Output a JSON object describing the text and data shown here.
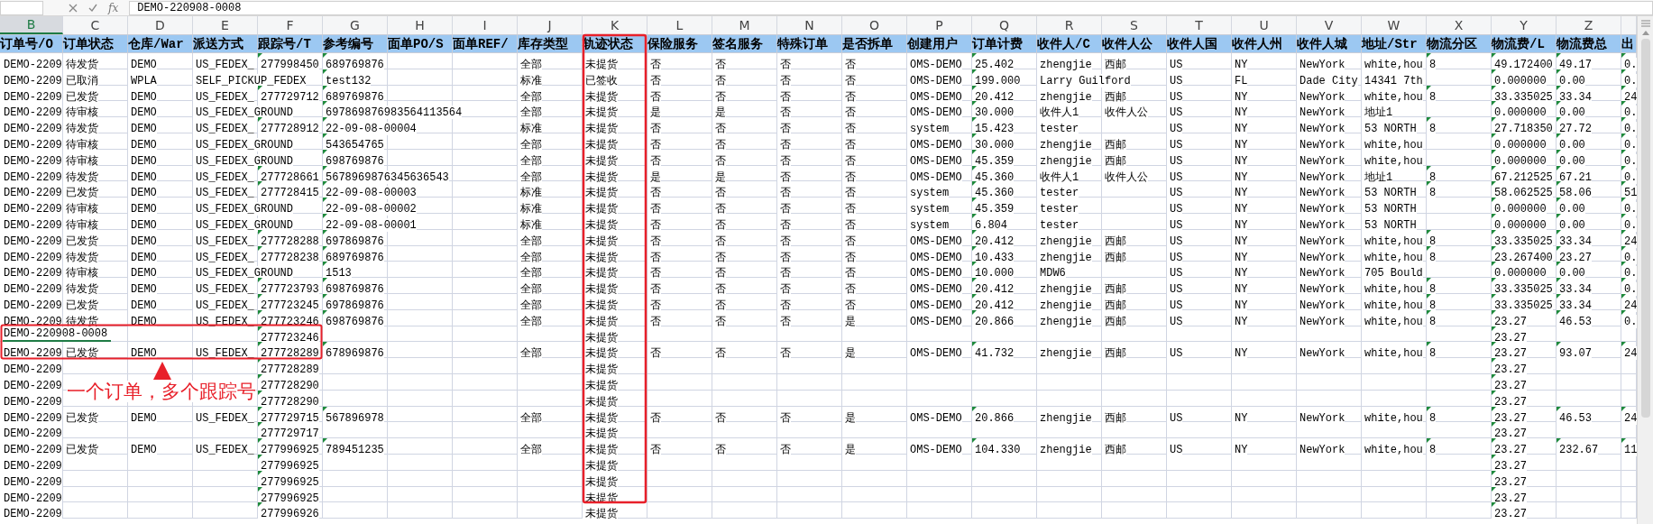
{
  "formula_bar": {
    "function_label": "fx",
    "value": "DEMO-220908-0008"
  },
  "columns": [
    {
      "letter": "B",
      "header": "订单号/O",
      "selected": true,
      "text_number_flag": false
    },
    {
      "letter": "C",
      "header": "订单状态",
      "selected": false,
      "text_number_flag": false
    },
    {
      "letter": "D",
      "header": "仓库/War",
      "selected": false,
      "text_number_flag": false
    },
    {
      "letter": "E",
      "header": "派送方式",
      "selected": false,
      "text_number_flag": false
    },
    {
      "letter": "F",
      "header": "跟踪号/T",
      "selected": false,
      "text_number_flag": true
    },
    {
      "letter": "G",
      "header": "参考编号",
      "selected": false,
      "text_number_flag": true
    },
    {
      "letter": "H",
      "header": "面单PO/S",
      "selected": false
    },
    {
      "letter": "I",
      "header": "面单REF/",
      "selected": false
    },
    {
      "letter": "J",
      "header": "库存类型",
      "selected": false,
      "text_number_flag": false
    },
    {
      "letter": "K",
      "header": "轨迹状态",
      "selected": false,
      "text_number_flag": false
    },
    {
      "letter": "L",
      "header": "保险服务",
      "selected": false,
      "text_number_flag": false
    },
    {
      "letter": "M",
      "header": "签名服务",
      "selected": false,
      "text_number_flag": false
    },
    {
      "letter": "N",
      "header": "特殊订单",
      "selected": false,
      "text_number_flag": false
    },
    {
      "letter": "O",
      "header": "是否拆单",
      "selected": false,
      "text_number_flag": false
    },
    {
      "letter": "P",
      "header": "创建用户",
      "selected": false,
      "text_number_flag": false
    },
    {
      "letter": "Q",
      "header": "订单计费",
      "selected": false,
      "text_number_flag": true
    },
    {
      "letter": "R",
      "header": "收件人/C",
      "selected": false,
      "text_number_flag": false
    },
    {
      "letter": "S",
      "header": "收件人公",
      "selected": false,
      "text_number_flag": false
    },
    {
      "letter": "T",
      "header": "收件人国",
      "selected": false,
      "text_number_flag": false
    },
    {
      "letter": "U",
      "header": "收件人州",
      "selected": false,
      "text_number_flag": false
    },
    {
      "letter": "V",
      "header": "收件人城",
      "selected": false,
      "text_number_flag": false
    },
    {
      "letter": "W",
      "header": "地址/Str",
      "selected": false,
      "text_number_flag": false
    },
    {
      "letter": "X",
      "header": "物流分区",
      "selected": false,
      "text_number_flag": true
    },
    {
      "letter": "Y",
      "header": "物流费/L",
      "selected": false,
      "text_number_flag": true
    },
    {
      "letter": "Z",
      "header": "物流费总",
      "selected": false,
      "text_number_flag": true
    },
    {
      "header": "出",
      "selected": false,
      "text_number_flag": true
    }
  ],
  "rows": [
    {
      "editing": false,
      "cells": [
        "DEMO-2209",
        "待发货",
        "DEMO",
        "US_FEDEX_",
        "277998450",
        "689769876",
        "",
        "",
        "全部",
        "未提货",
        "否",
        "否",
        "否",
        "否",
        "OMS-DEMO",
        "25.402",
        "zhengjie",
        "西邮",
        "US",
        "NY",
        "NewYork",
        "white,hou",
        "8",
        "49.172400",
        "49.17",
        "0."
      ]
    },
    {
      "editing": false,
      "cells": [
        "DEMO-2209",
        "已取消",
        "WPLA",
        "SELF_PICKUP_FEDEX",
        "",
        "test132",
        "",
        "",
        "标准",
        "已签收",
        "否",
        "否",
        "否",
        "否",
        "OMS-DEMO",
        "199.000",
        "Larry Guilford",
        "",
        "US",
        "FL",
        "Dade City",
        "14341 7th",
        "",
        "0.000000",
        "0.00",
        "0."
      ]
    },
    {
      "editing": false,
      "cells": [
        "DEMO-2209",
        "已发货",
        "DEMO",
        "US_FEDEX_",
        "277729712",
        "689769876",
        "",
        "",
        "全部",
        "未提货",
        "否",
        "否",
        "否",
        "否",
        "OMS-DEMO",
        "20.412",
        "zhengjie",
        "西邮",
        "US",
        "NY",
        "NewYork",
        "white,hou",
        "8",
        "33.335025",
        "33.34",
        "24"
      ]
    },
    {
      "editing": false,
      "cells": [
        "DEMO-2209",
        "待审核",
        "DEMO",
        "US_FEDEX_GROUND",
        "",
        "697869876983564113564",
        "",
        "",
        "全部",
        "未提货",
        "是",
        "是",
        "否",
        "否",
        "OMS-DEMO",
        "30.000",
        "收件人1",
        "收件人公",
        "US",
        "NY",
        "NewYork",
        "地址1",
        "",
        "0.000000",
        "0.00",
        "0."
      ]
    },
    {
      "editing": false,
      "cells": [
        "DEMO-2209",
        "待发货",
        "DEMO",
        "US_FEDEX_",
        "277728912",
        "22-09-08-00004",
        "",
        "",
        "标准",
        "未提货",
        "否",
        "否",
        "否",
        "否",
        "system",
        "15.423",
        "tester",
        "",
        "US",
        "NY",
        "NewYork",
        "53 NORTH",
        "8",
        "27.718350",
        "27.72",
        "0."
      ]
    },
    {
      "editing": false,
      "cells": [
        "DEMO-2209",
        "待审核",
        "DEMO",
        "US_FEDEX_GROUND",
        "",
        "543654765",
        "",
        "",
        "全部",
        "未提货",
        "否",
        "否",
        "否",
        "否",
        "OMS-DEMO",
        "30.000",
        "zhengjie",
        "西邮",
        "US",
        "NY",
        "NewYork",
        "white,hou",
        "",
        "0.000000",
        "0.00",
        "0."
      ]
    },
    {
      "editing": false,
      "cells": [
        "DEMO-2209",
        "待审核",
        "DEMO",
        "US_FEDEX_GROUND",
        "",
        "698769876",
        "",
        "",
        "全部",
        "未提货",
        "否",
        "否",
        "否",
        "否",
        "OMS-DEMO",
        "45.359",
        "zhengjie",
        "西邮",
        "US",
        "NY",
        "NewYork",
        "white,hou",
        "",
        "0.000000",
        "0.00",
        "0."
      ]
    },
    {
      "editing": false,
      "cells": [
        "DEMO-2209",
        "待发货",
        "DEMO",
        "US_FEDEX_",
        "277728661",
        "5678969876345636543",
        "",
        "",
        "全部",
        "未提货",
        "是",
        "是",
        "否",
        "否",
        "OMS-DEMO",
        "45.360",
        "收件人1",
        "收件人公",
        "US",
        "NY",
        "NewYork",
        "地址1",
        "8",
        "67.212525",
        "67.21",
        "0."
      ]
    },
    {
      "editing": false,
      "cells": [
        "DEMO-2209",
        "已发货",
        "DEMO",
        "US_FEDEX_",
        "277728415",
        "22-09-08-00003",
        "",
        "",
        "标准",
        "未提货",
        "否",
        "否",
        "否",
        "否",
        "system",
        "45.360",
        "tester",
        "",
        "US",
        "NY",
        "NewYork",
        "53 NORTH",
        "8",
        "58.062525",
        "58.06",
        "51"
      ]
    },
    {
      "editing": false,
      "cells": [
        "DEMO-2209",
        "待审核",
        "DEMO",
        "US_FEDEX_GROUND",
        "",
        "22-09-08-00002",
        "",
        "",
        "标准",
        "未提货",
        "否",
        "否",
        "否",
        "否",
        "system",
        "45.359",
        "tester",
        "",
        "US",
        "NY",
        "NewYork",
        "53 NORTH",
        "",
        "0.000000",
        "0.00",
        "0."
      ]
    },
    {
      "editing": false,
      "cells": [
        "DEMO-2209",
        "待审核",
        "DEMO",
        "US_FEDEX_GROUND",
        "",
        "22-09-08-00001",
        "",
        "",
        "标准",
        "未提货",
        "否",
        "否",
        "否",
        "否",
        "system",
        "6.804",
        "tester",
        "",
        "US",
        "NY",
        "NewYork",
        "53 NORTH",
        "",
        "0.000000",
        "0.00",
        "0."
      ]
    },
    {
      "editing": false,
      "cells": [
        "DEMO-2209",
        "已发货",
        "DEMO",
        "US_FEDEX_",
        "277728288",
        "697869876",
        "",
        "",
        "全部",
        "未提货",
        "否",
        "否",
        "否",
        "否",
        "OMS-DEMO",
        "20.412",
        "zhengjie",
        "西邮",
        "US",
        "NY",
        "NewYork",
        "white,hou",
        "8",
        "33.335025",
        "33.34",
        "24"
      ]
    },
    {
      "editing": false,
      "cells": [
        "DEMO-2209",
        "待发货",
        "DEMO",
        "US_FEDEX_",
        "277728238",
        "689769876",
        "",
        "",
        "全部",
        "未提货",
        "否",
        "否",
        "否",
        "否",
        "OMS-DEMO",
        "10.433",
        "zhengjie",
        "西邮",
        "US",
        "NY",
        "NewYork",
        "white,hou",
        "8",
        "23.267400",
        "23.27",
        "0."
      ]
    },
    {
      "editing": false,
      "cells": [
        "DEMO-2209",
        "待审核",
        "DEMO",
        "US_FEDEX_GROUND",
        "",
        "1513",
        "",
        "",
        "全部",
        "未提货",
        "否",
        "否",
        "否",
        "否",
        "OMS-DEMO",
        "10.000",
        "MDW6",
        "",
        "US",
        "NY",
        "NewYork",
        "705 Bould",
        "",
        "0.000000",
        "0.00",
        "0."
      ]
    },
    {
      "editing": false,
      "cells": [
        "DEMO-2209",
        "待发货",
        "DEMO",
        "US_FEDEX_",
        "277723793",
        "698769876",
        "",
        "",
        "全部",
        "未提货",
        "否",
        "否",
        "否",
        "否",
        "OMS-DEMO",
        "20.412",
        "zhengjie",
        "西邮",
        "US",
        "NY",
        "NewYork",
        "white,hou",
        "8",
        "33.335025",
        "33.34",
        "0."
      ]
    },
    {
      "editing": false,
      "cells": [
        "DEMO-2209",
        "已发货",
        "DEMO",
        "US_FEDEX_",
        "277723245",
        "697869876",
        "",
        "",
        "全部",
        "未提货",
        "否",
        "否",
        "否",
        "否",
        "OMS-DEMO",
        "20.412",
        "zhengjie",
        "西邮",
        "US",
        "NY",
        "NewYork",
        "white,hou",
        "8",
        "33.335025",
        "33.34",
        "24"
      ]
    },
    {
      "editing": false,
      "cells": [
        "DEMO-2209",
        "待发货",
        "DEMO",
        "US_FEDEX_",
        "277723246",
        "698769876",
        "",
        "",
        "全部",
        "未提货",
        "否",
        "否",
        "否",
        "是",
        "OMS-DEMO",
        "20.866",
        "zhengjie",
        "西邮",
        "US",
        "NY",
        "NewYork",
        "white,hou",
        "8",
        "23.27",
        "46.53",
        "0."
      ]
    },
    {
      "editing": true,
      "cells": [
        "DEMO-220908-0008",
        "",
        "",
        "",
        "277723246",
        "",
        "",
        "",
        "",
        "未提货",
        "",
        "",
        "",
        "",
        "",
        "",
        "",
        "",
        "",
        "",
        "",
        "",
        "",
        "23.27",
        "",
        ""
      ]
    },
    {
      "editing": false,
      "cells": [
        "DEMO-2209",
        "已发货",
        "DEMO",
        "US_FEDEX_",
        "277728289",
        "678969876",
        "",
        "",
        "全部",
        "未提货",
        "否",
        "否",
        "否",
        "是",
        "OMS-DEMO",
        "41.732",
        "zhengjie",
        "西邮",
        "US",
        "NY",
        "NewYork",
        "white,hou",
        "8",
        "23.27",
        "93.07",
        "24"
      ]
    },
    {
      "editing": false,
      "cells": [
        "DEMO-2209",
        "",
        "",
        "",
        "277728289",
        "",
        "",
        "",
        "",
        "未提货",
        "",
        "",
        "",
        "",
        "",
        "",
        "",
        "",
        "",
        "",
        "",
        "",
        "",
        "23.27",
        "",
        ""
      ]
    },
    {
      "editing": false,
      "cells": [
        "DEMO-2209",
        "",
        "",
        "",
        "277728290",
        "",
        "",
        "",
        "",
        "未提货",
        "",
        "",
        "",
        "",
        "",
        "",
        "",
        "",
        "",
        "",
        "",
        "",
        "",
        "23.27",
        "",
        ""
      ]
    },
    {
      "editing": false,
      "cells": [
        "DEMO-2209",
        "",
        "",
        "",
        "277728290",
        "",
        "",
        "",
        "",
        "未提货",
        "",
        "",
        "",
        "",
        "",
        "",
        "",
        "",
        "",
        "",
        "",
        "",
        "",
        "23.27",
        "",
        ""
      ]
    },
    {
      "editing": false,
      "cells": [
        "DEMO-2209",
        "已发货",
        "DEMO",
        "US_FEDEX_",
        "277729715",
        "567896978",
        "",
        "",
        "全部",
        "未提货",
        "否",
        "否",
        "否",
        "是",
        "OMS-DEMO",
        "20.866",
        "zhengjie",
        "西邮",
        "US",
        "NY",
        "NewYork",
        "white,hou",
        "8",
        "23.27",
        "46.53",
        "24"
      ]
    },
    {
      "editing": false,
      "cells": [
        "DEMO-2209",
        "",
        "",
        "",
        "277729717",
        "",
        "",
        "",
        "",
        "未提货",
        "",
        "",
        "",
        "",
        "",
        "",
        "",
        "",
        "",
        "",
        "",
        "",
        "",
        "23.27",
        "",
        ""
      ]
    },
    {
      "editing": false,
      "cells": [
        "DEMO-2209",
        "已发货",
        "DEMO",
        "US_FEDEX_",
        "277996925",
        "789451235",
        "",
        "",
        "全部",
        "未提货",
        "否",
        "否",
        "否",
        "是",
        "OMS-DEMO",
        "104.330",
        "zhengjie",
        "西邮",
        "US",
        "NY",
        "NewYork",
        "white,hou",
        "8",
        "23.27",
        "232.67",
        "11"
      ]
    },
    {
      "editing": false,
      "cells": [
        "DEMO-2209",
        "",
        "",
        "",
        "277996925",
        "",
        "",
        "",
        "",
        "未提货",
        "",
        "",
        "",
        "",
        "",
        "",
        "",
        "",
        "",
        "",
        "",
        "",
        "",
        "23.27",
        "",
        ""
      ]
    },
    {
      "editing": false,
      "cells": [
        "DEMO-2209",
        "",
        "",
        "",
        "277996925",
        "",
        "",
        "",
        "",
        "未提货",
        "",
        "",
        "",
        "",
        "",
        "",
        "",
        "",
        "",
        "",
        "",
        "",
        "",
        "23.27",
        "",
        ""
      ]
    },
    {
      "editing": false,
      "cells": [
        "DEMO-2209",
        "",
        "",
        "",
        "277996925",
        "",
        "",
        "",
        "",
        "未提货",
        "",
        "",
        "",
        "",
        "",
        "",
        "",
        "",
        "",
        "",
        "",
        "",
        "",
        "23.27",
        "",
        ""
      ]
    },
    {
      "editing": false,
      "cells": [
        "DEMO-2209",
        "",
        "",
        "",
        "277996926",
        "",
        "",
        "",
        "",
        "未提货",
        "",
        "",
        "",
        "",
        "",
        "",
        "",
        "",
        "",
        "",
        "",
        "",
        "",
        "23.27",
        "",
        ""
      ]
    }
  ],
  "annotation": {
    "text": "一个订单，多个跟踪号"
  }
}
